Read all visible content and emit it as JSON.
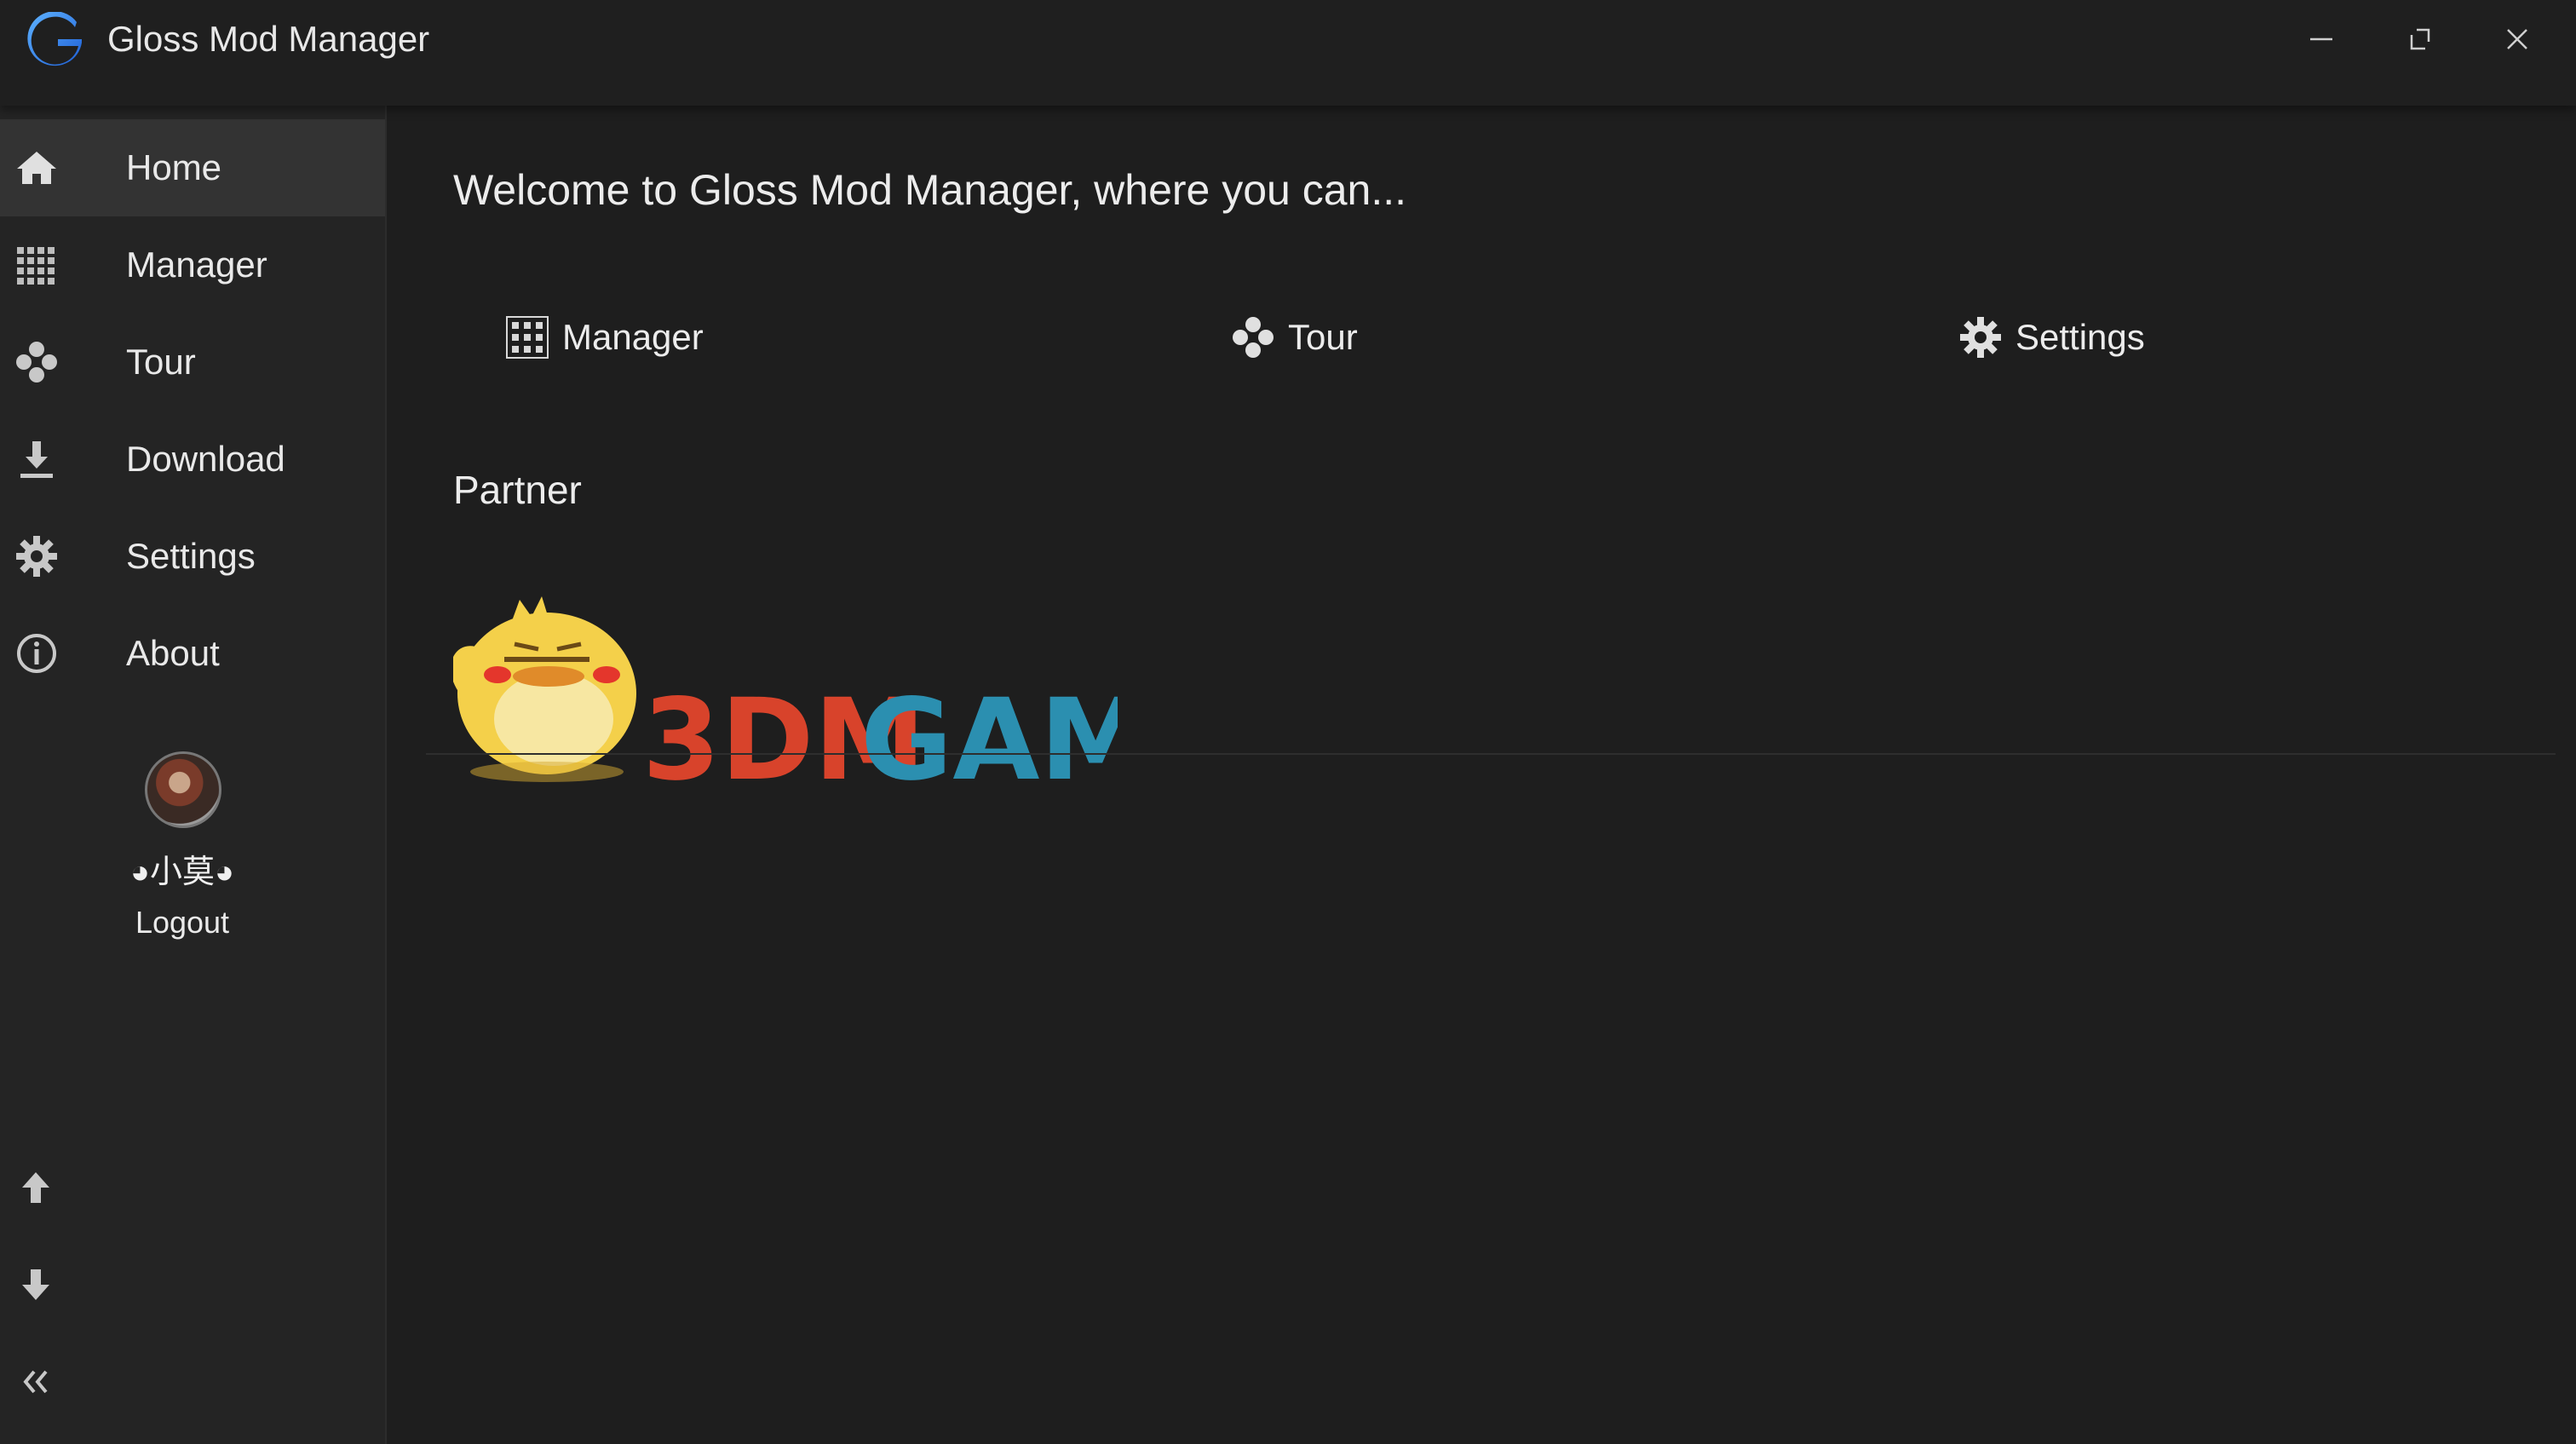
{
  "app": {
    "title": "Gloss Mod Manager",
    "logo_icon": "gloss-g-logo-icon",
    "accent": "#2f7fe0"
  },
  "window_controls": {
    "minimize_icon": "minimize-icon",
    "maximize_icon": "maximize-icon",
    "close_icon": "close-icon"
  },
  "sidebar": {
    "items": [
      {
        "label": "Home",
        "icon": "home-icon",
        "active": true
      },
      {
        "label": "Manager",
        "icon": "grid-icon",
        "active": false
      },
      {
        "label": "Tour",
        "icon": "gamepad-icon",
        "active": false
      },
      {
        "label": "Download",
        "icon": "download-icon",
        "active": false
      },
      {
        "label": "Settings",
        "icon": "gear-icon",
        "active": false
      },
      {
        "label": "About",
        "icon": "info-icon",
        "active": false
      }
    ],
    "user": {
      "name": "◕小莫◕",
      "logout_label": "Logout"
    },
    "tools": [
      "arrow-up-icon",
      "arrow-down-icon",
      "collapse-icon"
    ]
  },
  "main": {
    "welcome": "Welcome to Gloss Mod Manager, where you can...",
    "quick_links": [
      {
        "label": "Manager",
        "icon": "grid-icon"
      },
      {
        "label": "Tour",
        "icon": "gamepad-icon"
      },
      {
        "label": "Settings",
        "icon": "gear-icon"
      }
    ],
    "partner_title": "Partner",
    "partner_logo_text_a": "3DM",
    "partner_logo_text_b": "GAME"
  },
  "colors": {
    "background": "#1e1e1e",
    "sidebar": "#242424",
    "active_item": "#333333",
    "partner_red": "#d8432b",
    "partner_blue": "#2b8fb0"
  }
}
